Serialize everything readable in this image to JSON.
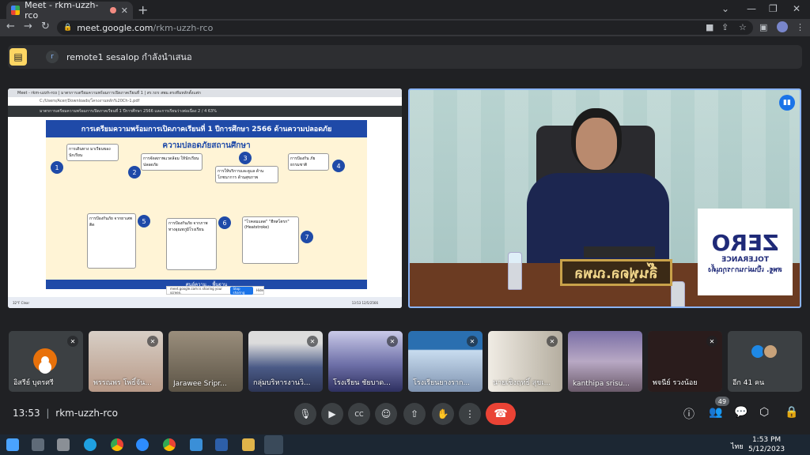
{
  "browser": {
    "tab_title": "Meet - rkm-uzzh-rco",
    "new_tab": "+",
    "win_min": "⌄",
    "host": "meet.google.com",
    "path": "/rkm-uzzh-rco"
  },
  "banner": {
    "avatar_letter": "r",
    "text": "remote1 sesalop กำลังนำเสนอ"
  },
  "presentation": {
    "browser_tabs": "Meet - rkm-uzzh-rco   |   มาตรการเตรียมความพร้อมการเปิดภาคเรียนที่ 1   |   สร.รถร สพม.ตรงทีมหลักตั้งแต่ก",
    "url": "C:/Users/Acer/Downloads/โครงงานหลัก%20Ch-1.pdf",
    "pdf_toolbar": "มาตรการเตรียมความพร้อมการเปิดภาคเรียนที่ 1 ปีการศึกษา 2566 และการเรียนว่างต่อเนื่อง     2 / 4     63%",
    "slide_title": "การเตรียมความพร้อมการเปิดภาคเรียนที่ 1 ปีการศึกษา 2566 ด้านความปลอดภัย",
    "slide_subtitle": "ความปลอดภัยสถานศึกษา",
    "items": [
      {
        "num": "1",
        "text": "การเดินทาง มาเรียนของนักเรียน"
      },
      {
        "num": "2",
        "text": "การจัดสภาพแวดล้อม ให้นักเรียนปลอดภัย"
      },
      {
        "num": "3",
        "text": "การให้บริการและดูแล ด้านโภชนาการ ด้านสุขภาพ"
      },
      {
        "num": "4",
        "text": "การป้องกัน ภัยธรรมชาติ"
      },
      {
        "num": "5",
        "text": "การป้องกันภัย จากยาเสพติด"
      },
      {
        "num": "6",
        "text": "การป้องกันภัย จากภาพทางอุณหภูมิโรงเรียน"
      },
      {
        "num": "7",
        "text": "\"โรคลมแดด\" \"ฮีทสโตรก\" (Heatstroke)"
      }
    ],
    "footer": "ศูนย์ความ...                                      พื้นฐาน",
    "share_text": "meet.google.com is sharing your screen.",
    "share_stop": "Stop sharing",
    "share_hide": "Hide",
    "taskbar_text": "32°F Clear",
    "taskbar_time": "13:53 12/5/2566"
  },
  "speaker": {
    "nameplate": "ลิ๊นฟูดล.ณพล",
    "sign_title": "ZERO",
    "sign_line1": "TOLERANCE",
    "sign_line2": "สพฐ. เป็นผ่านการกุณุตั้ง",
    "audio_icon": "audio-level-icon"
  },
  "participants": [
    {
      "name": "อิสรีย์ บุตรศรี",
      "avatar": true,
      "bg": "#3c4043"
    },
    {
      "name": "พรรณพร โพธิ์จัน...",
      "bg": "#c6b6ac"
    },
    {
      "name": "Jarawee Sripr...",
      "bg": "#8a7d6a"
    },
    {
      "name": "กลุ่มบริหารงานวิ...",
      "bg": "#5f6e90"
    },
    {
      "name": "โรงเรียน ชัยบาด...",
      "bg": "#7e7fb0"
    },
    {
      "name": "โรงเรียนยางราก...",
      "bg": "#6a8aa8"
    },
    {
      "name": "นายเชิงฤทธิ์ สุขเ...",
      "bg": "#c8c2b8"
    },
    {
      "name": "kanthipa srisu...",
      "bg": "#8e7fa0"
    },
    {
      "name": "พจนีย์ รวงน้อย",
      "bg": "#3a2a2a"
    }
  ],
  "more": {
    "label": "อีก 41 คน"
  },
  "controls": {
    "time": "13:53",
    "separator": "|",
    "meeting_code": "rkm-uzzh-rco",
    "participant_count": "49"
  },
  "taskbar": {
    "time": "1:53 PM",
    "date": "5/12/2023",
    "lang": "ไทย"
  },
  "colors": {
    "accent": "#8ab4f8",
    "end_call": "#ea4335",
    "banner_icon": "#fdd663"
  }
}
